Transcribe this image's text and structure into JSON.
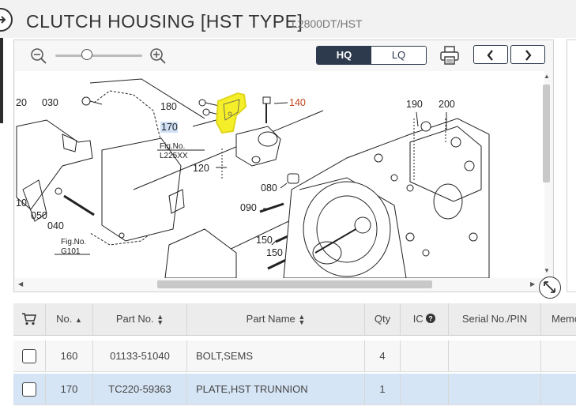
{
  "header": {
    "title": "CLUTCH HOUSING [HST TYPE]",
    "model": "L2800DT/HST"
  },
  "viewer": {
    "quality_hq": "HQ",
    "quality_lq": "LQ",
    "quality_selected": "HQ",
    "zoom_level": 0.35,
    "diagram": {
      "callouts": [
        "20",
        "030",
        "180",
        "170",
        "140",
        "190",
        "200",
        "120",
        "080",
        "10",
        "050",
        "040",
        "090",
        "150",
        "150"
      ],
      "fig_refs": [
        {
          "label": "Fig.No.",
          "ref": "L225XX"
        },
        {
          "label": "Fig.No.",
          "ref": "G101"
        }
      ],
      "highlighted_part": "170"
    }
  },
  "table": {
    "columns": {
      "cart": "",
      "no": "No.",
      "part_no": "Part No.",
      "part_name": "Part Name",
      "qty": "Qty",
      "ic": "IC",
      "serial": "Serial No./PIN",
      "memo": "Memo"
    },
    "rows": [
      {
        "no": "160",
        "part_no": "01133-51040",
        "part_name": "BOLT,SEMS",
        "qty": "4",
        "selected": false
      },
      {
        "no": "170",
        "part_no": "TC220-59363",
        "part_name": "PLATE,HST TRUNNION",
        "qty": "1",
        "selected": true
      }
    ]
  },
  "colors": {
    "accent": "#2d3a4e",
    "highlight": "#f5ef2a",
    "selected_row": "#d6e5f5",
    "callout_orange": "#c0441c"
  },
  "icons": {
    "back": "arrow-right-circle-icon",
    "zoom_out": "zoom-out-icon",
    "zoom_in": "zoom-in-icon",
    "print": "printer-icon",
    "prev": "chevron-left-icon",
    "next": "chevron-right-icon",
    "expand": "expand-arrows-icon",
    "cart": "cart-icon",
    "info": "question-circle-icon"
  }
}
